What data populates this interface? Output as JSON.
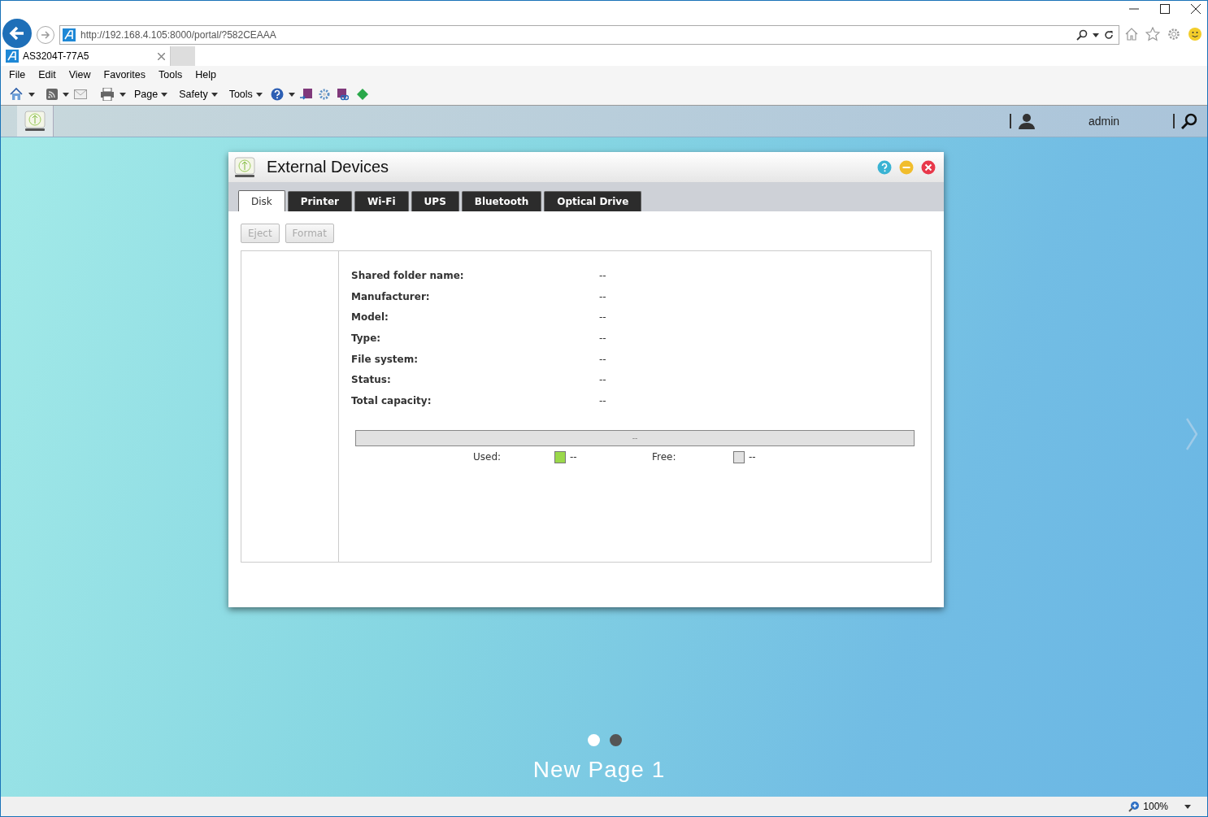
{
  "browser": {
    "address": "http://192.168.4.105:8000/portal/?582CEAAA",
    "tab": {
      "title": "AS3204T-77A5"
    },
    "menu": [
      "File",
      "Edit",
      "View",
      "Favorites",
      "Tools",
      "Help"
    ],
    "command_bar": [
      "Page",
      "Safety",
      "Tools"
    ],
    "zoom": "100%"
  },
  "portal": {
    "user": "admin"
  },
  "dialog": {
    "title": "External Devices",
    "tabs": [
      {
        "label": "Disk",
        "selected": true
      },
      {
        "label": "Printer",
        "selected": false
      },
      {
        "label": "Wi-Fi",
        "selected": false
      },
      {
        "label": "UPS",
        "selected": false
      },
      {
        "label": "Bluetooth",
        "selected": false
      },
      {
        "label": "Optical Drive",
        "selected": false
      }
    ],
    "buttons": [
      {
        "label": "Eject",
        "disabled": true
      },
      {
        "label": "Format",
        "disabled": true
      }
    ],
    "fields": [
      {
        "label": "Shared folder name:",
        "value": "--"
      },
      {
        "label": "Manufacturer:",
        "value": "--"
      },
      {
        "label": "Model:",
        "value": "--"
      },
      {
        "label": "Type:",
        "value": "--"
      },
      {
        "label": "File system:",
        "value": "--"
      },
      {
        "label": "Status:",
        "value": "--"
      },
      {
        "label": "Total capacity:",
        "value": "--"
      }
    ],
    "capacity": {
      "bar_text": "--",
      "legend": [
        {
          "label": "Used:",
          "value": "--",
          "color": "#9ad84a"
        },
        {
          "label": "Free:",
          "value": "--",
          "color": "#e2e2e2"
        }
      ]
    }
  },
  "desktop": {
    "pages": [
      {
        "selected": true
      },
      {
        "selected": false
      }
    ],
    "page_title": "New Page 1"
  }
}
